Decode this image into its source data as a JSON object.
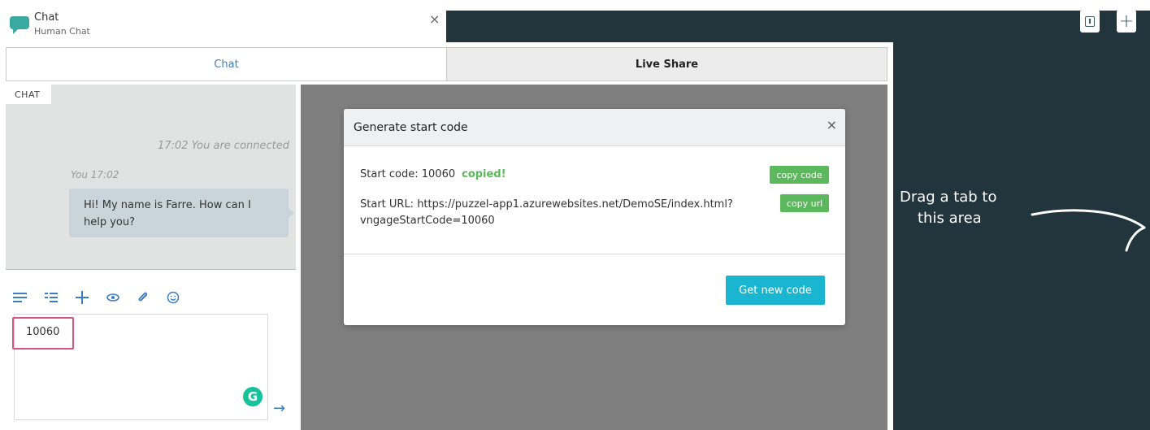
{
  "header": {
    "title": "Chat",
    "subtitle": "Human Chat",
    "close_icon": "×",
    "logo_icon": "chat-bubble-icon"
  },
  "tabs": [
    {
      "label": "Chat",
      "active": true
    },
    {
      "label": "Live Share",
      "active": false
    }
  ],
  "chat": {
    "section_label": "CHAT",
    "system_message": "17:02 You are connected",
    "message_meta": "You 17:02",
    "message_text": "Hi! My name is Farre. How can I help you?",
    "input_value": "10060",
    "send_icon": "→",
    "grammarly_letter": "G",
    "toolbar_icons": [
      "text-lines-icon",
      "list-icon",
      "plus-icon",
      "eye-icon",
      "paperclip-icon",
      "smiley-icon"
    ]
  },
  "modal": {
    "title": "Generate start code",
    "close_icon": "×",
    "start_code_text": "Start code: 10060",
    "copied_text": "copied!",
    "copy_code_label": "copy code",
    "start_url_text": "Start URL: https://puzzel-app1.azurewebsites.net/DemoSE/index.html?vngageStartCode=10060",
    "copy_url_label": "copy url",
    "new_code_label": "Get new code"
  },
  "drop_area": {
    "line1": "Drag a tab to",
    "line2": "this area",
    "add_label": "+"
  },
  "colors": {
    "dark_bg": "#22343c",
    "accent_blue": "#4d7ea8",
    "green": "#5cb85c",
    "teal": "#1ab6cf",
    "highlight": "#d4557e"
  }
}
